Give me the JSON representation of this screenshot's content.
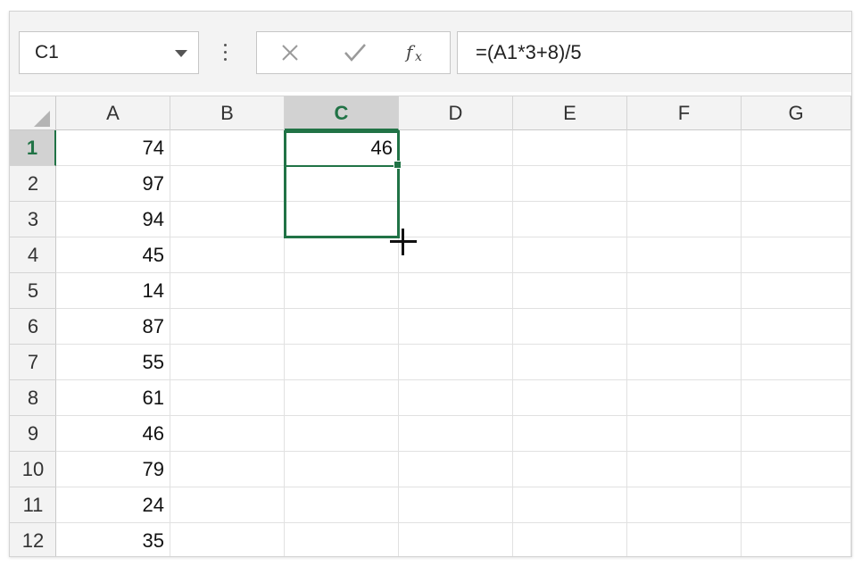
{
  "name_box": {
    "value": "C1"
  },
  "formula_bar": {
    "value": "=(A1*3+8)/5"
  },
  "columns": [
    "A",
    "B",
    "C",
    "D",
    "E",
    "F",
    "G"
  ],
  "selected_column": "C",
  "rows": [
    "1",
    "2",
    "3",
    "4",
    "5",
    "6",
    "7",
    "8",
    "9",
    "10",
    "11",
    "12"
  ],
  "selected_row": "1",
  "column_a_values": [
    "74",
    "97",
    "94",
    "45",
    "14",
    "87",
    "55",
    "61",
    "46",
    "79",
    "24",
    "35"
  ],
  "cell_c1_value": "46",
  "colors": {
    "accent": "#217346",
    "header_bg": "#f3f3f3",
    "selected_header_bg": "#d2d2d2"
  },
  "icons": {
    "cancel": "close-icon",
    "enter": "checkmark-icon",
    "insert_function": "fx-icon"
  }
}
